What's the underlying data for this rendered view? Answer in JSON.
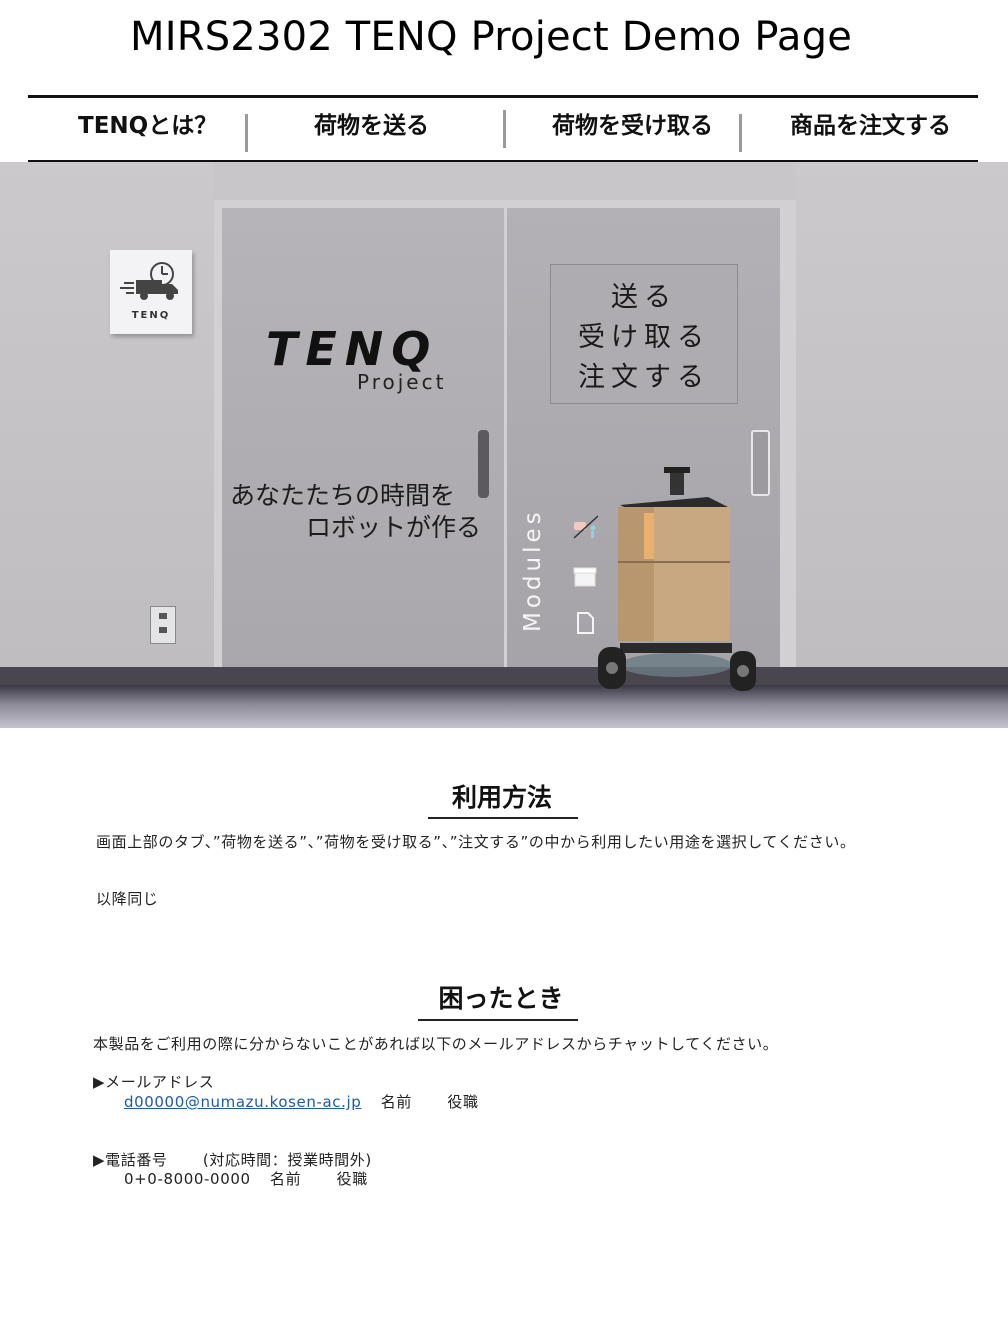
{
  "header": {
    "title": "MIRS2302 TENQ Project Demo Page"
  },
  "nav": {
    "items": [
      {
        "label": "TENQとは？"
      },
      {
        "label": "荷物を送る"
      },
      {
        "label": "荷物を受け取る"
      },
      {
        "label": "商品を注文する"
      }
    ]
  },
  "hero": {
    "sign_text": "TENQ",
    "logo_title": "TENQ",
    "logo_subtitle": "Project",
    "window_lines": [
      "送る",
      "受け取る",
      "注文する"
    ],
    "tagline_line1": "あなたたちの時間を",
    "tagline_line2": "ロボットが作る",
    "modules_label": "Modules"
  },
  "usage": {
    "heading": "利用方法",
    "paragraph": "画面上部のタブ、”荷物を送る”、”荷物を受け取る”、”注文する”の中から利用したい用途を選択してください。",
    "note": "以降同じ"
  },
  "help": {
    "heading": "困ったとき",
    "intro": "本製品をご利用の際に分からないことがあれば以下のメールアドレスからチャットしてください。",
    "email_label": "▶メールアドレス",
    "email": "d00000@numazu.kosen-ac.jp",
    "email_name": "名前",
    "email_role": "役職",
    "phone_label": "▶電話番号",
    "phone_hours": "(対応時間：授業時間外)",
    "phone": "0+0-8000-0000",
    "phone_name": "名前",
    "phone_role": "役職"
  },
  "colors": {
    "link": "#1f5aa6",
    "nav_border": "#111111",
    "nav_separator": "#9a9a9a"
  }
}
